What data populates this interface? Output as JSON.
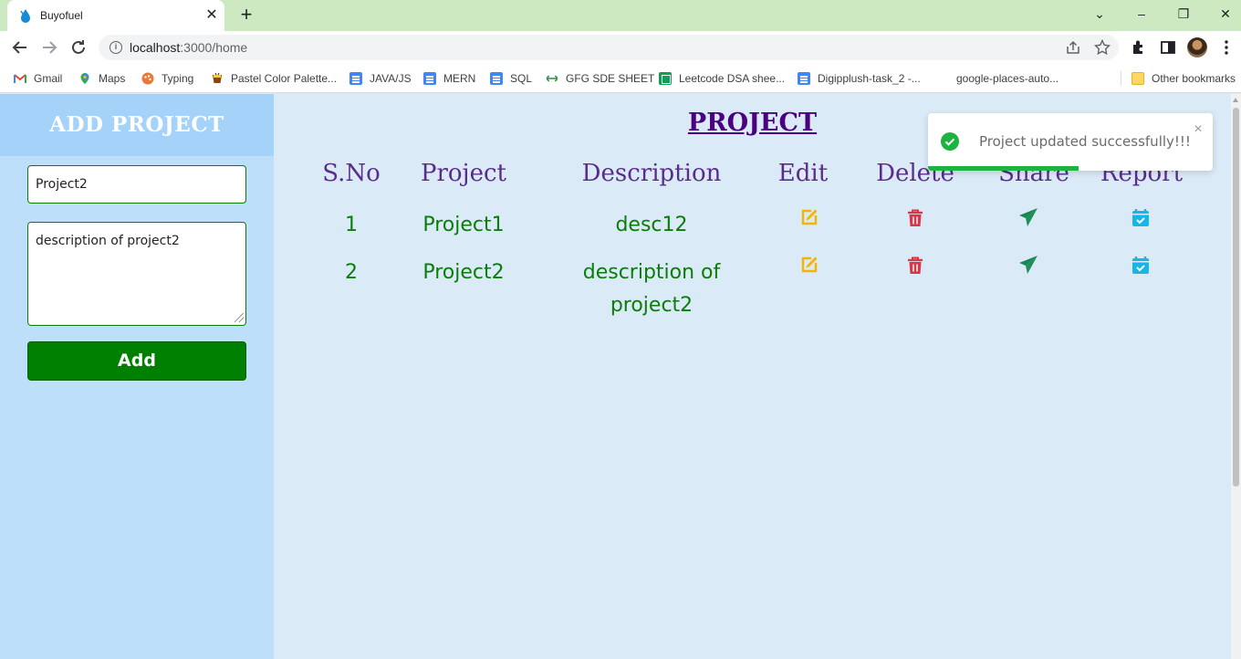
{
  "browser": {
    "tab_title": "Buyofuel",
    "tab_close": "✕",
    "new_tab": "+",
    "url_host": "localhost",
    "url_path": ":3000/home",
    "window_controls": {
      "minimize": "–",
      "restore": "❐",
      "close": "✕",
      "tab_search": "⌄"
    },
    "bookmarks": [
      {
        "label": "Gmail",
        "icon": "gmail-icon"
      },
      {
        "label": "Maps",
        "icon": "maps-icon"
      },
      {
        "label": "Typing",
        "icon": "typing-icon"
      },
      {
        "label": "Pastel Color Palette...",
        "icon": "palette-icon"
      },
      {
        "label": "JAVA/JS",
        "icon": "doc-icon"
      },
      {
        "label": "MERN",
        "icon": "doc-icon"
      },
      {
        "label": "SQL",
        "icon": "doc-icon"
      },
      {
        "label": "GFG SDE SHEET",
        "icon": "gfg-icon"
      },
      {
        "label": "Leetcode DSA shee...",
        "icon": "sheet-icon"
      },
      {
        "label": "Digipplush-task_2 -...",
        "icon": "doc-icon"
      },
      {
        "label": "google-places-auto...",
        "icon": "blank-icon"
      }
    ],
    "other_bookmarks": "Other bookmarks"
  },
  "sidebar": {
    "title": "ADD PROJECT",
    "project_input_value": "Project2",
    "description_value": "description of project2",
    "add_button": "Add"
  },
  "main": {
    "title": "PROJECT",
    "columns": [
      "S.No",
      "Project",
      "Description",
      "Edit",
      "Delete",
      "Share",
      "Report"
    ],
    "rows": [
      {
        "sno": "1",
        "project": "Project1",
        "description": "desc12"
      },
      {
        "sno": "2",
        "project": "Project2",
        "description": "description of project2"
      }
    ]
  },
  "toast": {
    "message": "Project updated successfully!!!",
    "close": "×",
    "progress": 0.53
  },
  "colors": {
    "edit": "#f5b400",
    "delete": "#dc3545",
    "share": "#198754",
    "report": "#17b6e6",
    "success": "#1cb33f"
  }
}
